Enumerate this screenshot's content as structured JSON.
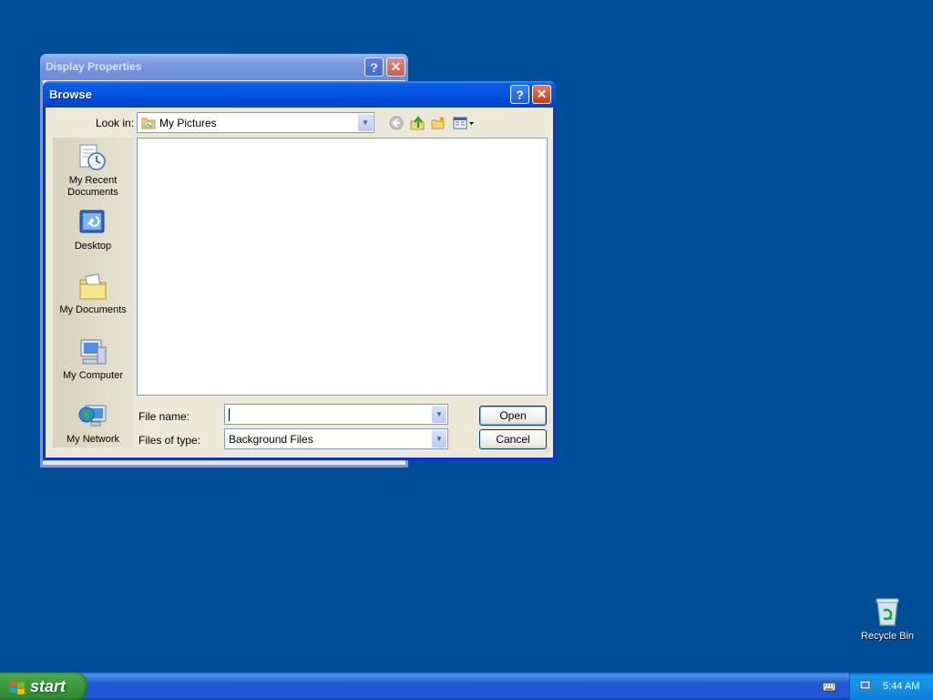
{
  "desktop": {
    "background_color": "#004e98",
    "recycle_bin_label": "Recycle Bin"
  },
  "background_window": {
    "title": "Display Properties",
    "help_label": "?",
    "close_label": "✕"
  },
  "dialog": {
    "title": "Browse",
    "help_label": "?",
    "close_label": "✕",
    "look_in_label": "Look in:",
    "look_in_value": "My Pictures",
    "toolbar_icons": [
      "back-icon",
      "up-folder-icon",
      "new-folder-icon",
      "view-menu-icon"
    ],
    "places": [
      {
        "label": "My Recent Documents",
        "icon": "recent-documents-icon"
      },
      {
        "label": "Desktop",
        "icon": "desktop-icon"
      },
      {
        "label": "My Documents",
        "icon": "my-documents-icon"
      },
      {
        "label": "My Computer",
        "icon": "my-computer-icon"
      },
      {
        "label": "My Network",
        "icon": "my-network-icon"
      }
    ],
    "file_name_label": "File name:",
    "file_name_value": "",
    "files_of_type_label": "Files of type:",
    "files_of_type_value": "Background Files",
    "open_label": "Open",
    "cancel_label": "Cancel",
    "accent_color": "#0054e3"
  },
  "taskbar": {
    "start_label": "start",
    "clock": "5:44 AM"
  }
}
